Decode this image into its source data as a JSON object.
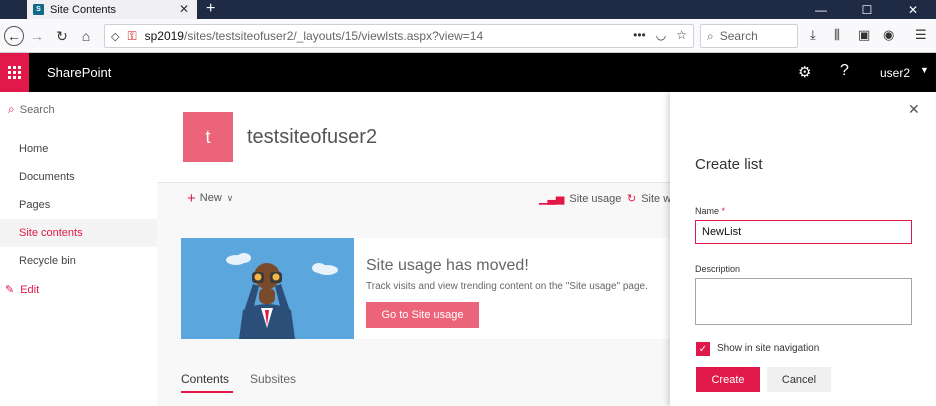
{
  "browser": {
    "tab_title": "Site Contents",
    "tab_favicon_text": "S",
    "url_host": "sp2019",
    "url_path": "/sites/testsiteofuser2/_layouts/15/viewlsts.aspx?view=14",
    "search_placeholder": "Search"
  },
  "suite": {
    "app_name": "SharePoint",
    "user": "user2",
    "accent": "#e1184a"
  },
  "leftnav": {
    "search_label": "Search",
    "items": [
      {
        "label": "Home"
      },
      {
        "label": "Documents"
      },
      {
        "label": "Pages"
      },
      {
        "label": "Site contents"
      },
      {
        "label": "Recycle bin"
      }
    ],
    "edit_label": "Edit"
  },
  "site": {
    "logo_letter": "t",
    "title": "testsiteofuser2"
  },
  "commandbar": {
    "new_label": "New",
    "site_usage_label": "Site usage",
    "site_workflows_label": "Site w"
  },
  "banner": {
    "heading": "Site usage has moved!",
    "text": "Track visits and view trending content on the \"Site usage\" page.",
    "button": "Go to Site usage"
  },
  "pivots": {
    "contents": "Contents",
    "subsites": "Subsites"
  },
  "panel": {
    "title": "Create list",
    "name_label": "Name",
    "required_mark": "*",
    "name_value": "NewList",
    "description_label": "Description",
    "show_in_nav_label": "Show in site navigation",
    "show_in_nav_checked": true,
    "create_button": "Create",
    "cancel_button": "Cancel"
  }
}
